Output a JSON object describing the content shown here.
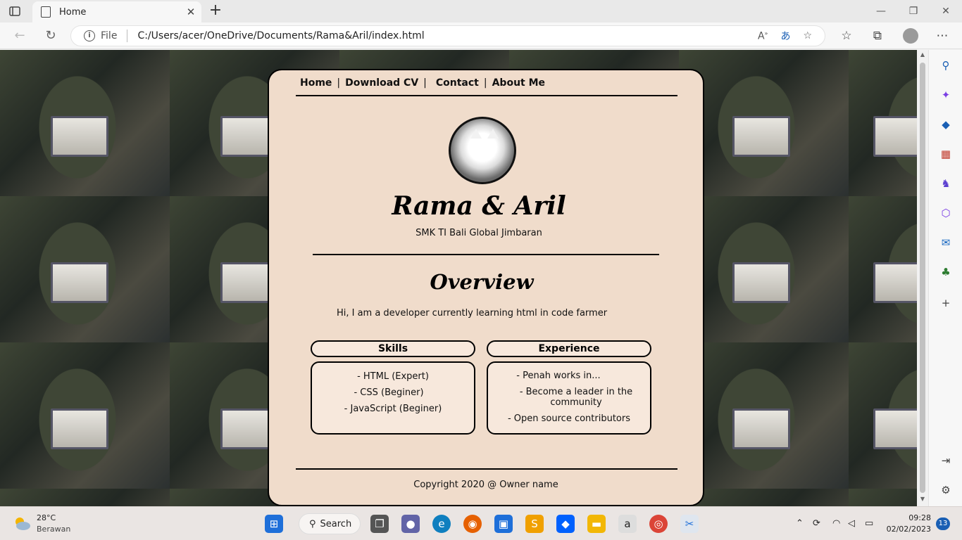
{
  "browser": {
    "tab_title": "Home",
    "close_tab": "✕",
    "new_tab": "+",
    "address_scheme_label": "File",
    "url": "C:/Users/acer/OneDrive/Documents/Rama&Aril/index.html",
    "window_controls": {
      "minimize": "—",
      "restore": "❐",
      "close": "✕"
    }
  },
  "page": {
    "nav": {
      "home": "Home",
      "download_cv": "Download CV",
      "contact": "Contact",
      "about": "About Me",
      "separator": "|"
    },
    "name": "Rama & Aril",
    "school": "SMK TI Bali Global Jimbaran",
    "overview_heading": "Overview",
    "intro": "Hi, I am a developer currently learning html in code farmer",
    "skills": {
      "title": "Skills",
      "items": [
        "- HTML (Expert)",
        "- CSS (Beginer)",
        "- JavaScript (Beginer)"
      ]
    },
    "experience": {
      "title": "Experience",
      "items": [
        "- Penah works in...",
        "- Become a leader in the",
        "community",
        "- Open source contributors"
      ]
    },
    "footer": "Copyright 2020 @ Owner name",
    "card_bg": "#f0dccb"
  },
  "taskbar": {
    "weather_temp": "28°C",
    "weather_desc": "Berawan",
    "search_label": "Search",
    "time": "09:28",
    "date": "02/02/2023",
    "notifications": "13"
  }
}
